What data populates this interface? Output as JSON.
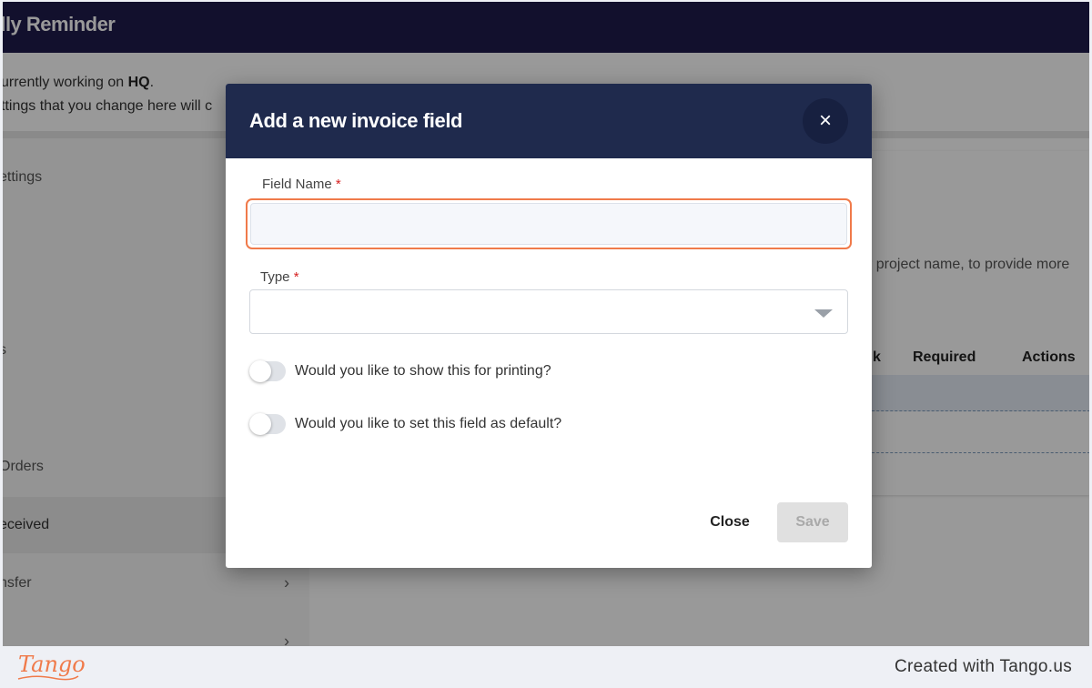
{
  "app": {
    "title": "dly Reminder",
    "notice_prefix": "urrently working on ",
    "notice_branch": "HQ",
    "notice_suffix": ".",
    "notice_line2": "ttings that you change here will c",
    "description_fragment": "r project name, to provide more",
    "table_headers": [
      "k",
      "Required",
      "Actions"
    ],
    "sidebar": [
      {
        "label": "ettings",
        "chevron": false,
        "active": false
      },
      {
        "label": "s",
        "chevron": false,
        "active": false
      },
      {
        "label": "'",
        "chevron": false,
        "active": false
      },
      {
        "label": "Orders",
        "chevron": false,
        "active": false
      },
      {
        "label": "eceived",
        "chevron": false,
        "active": true
      },
      {
        "label": "nsfer",
        "chevron": true,
        "active": false
      },
      {
        "label": "",
        "chevron": true,
        "active": false
      }
    ],
    "chevron_glyph": "›"
  },
  "modal": {
    "title": "Add a new invoice field",
    "close_icon": "×",
    "field_name_label": "Field Name",
    "field_name_value": "",
    "required_mark": "*",
    "type_label": "Type",
    "type_value": "",
    "toggles": [
      {
        "label": "Would you like to show this for printing?",
        "on": false
      },
      {
        "label": "Would you like to set this field as default?",
        "on": false
      }
    ],
    "close_button": "Close",
    "save_button": "Save"
  },
  "footer": {
    "logo_text": "Tango",
    "credit": "Created with Tango.us"
  },
  "colors": {
    "header": "#1e1b4b",
    "modal_header": "#1f2a4d",
    "focus_outline": "#f07a4a",
    "required": "#d62020"
  }
}
